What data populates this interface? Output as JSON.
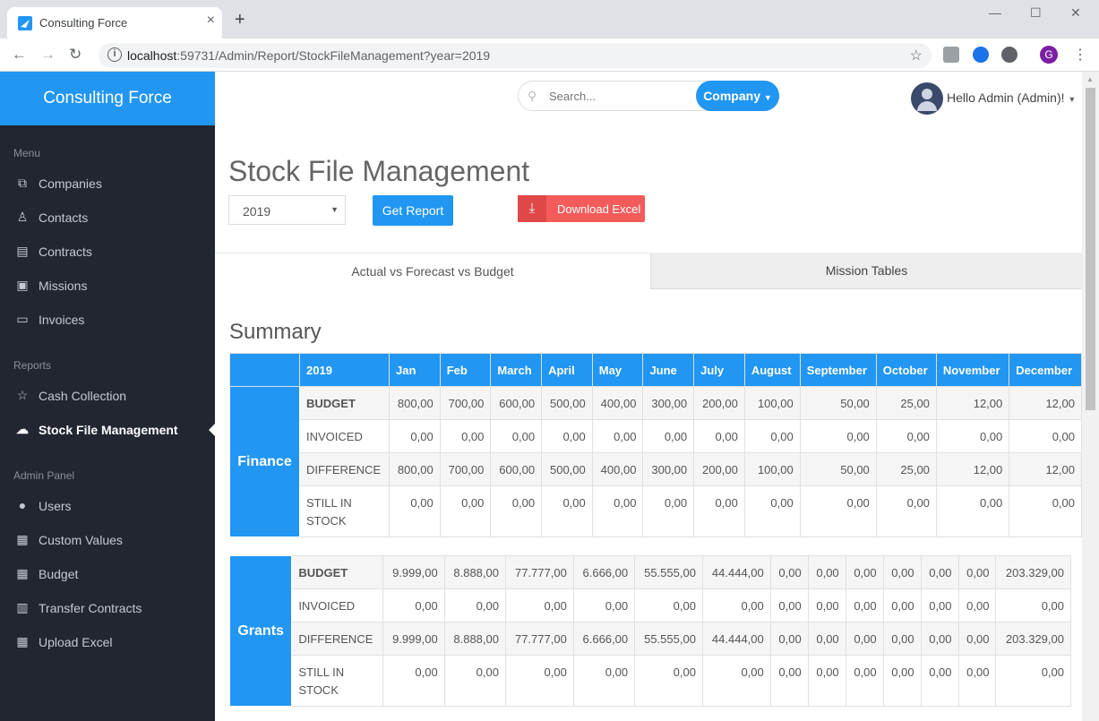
{
  "browser": {
    "tab_title": "Consulting Force",
    "tab_close": "×",
    "new_tab": "+",
    "url_host": "localhost",
    "url_path": ":59731/Admin/Report/StockFileManagement?year=2019",
    "profile_letter": "G",
    "icons": [
      "back-icon",
      "forward-icon",
      "reload-icon",
      "info-icon",
      "star-icon",
      "menu-dots-icon"
    ]
  },
  "sidebar": {
    "brand": "Consulting Force",
    "sections": {
      "menu": "Menu",
      "reports": "Reports",
      "admin": "Admin Panel"
    },
    "menu_items": [
      {
        "label": "Companies",
        "icon": "companies-icon"
      },
      {
        "label": "Contacts",
        "icon": "contacts-icon"
      },
      {
        "label": "Contracts",
        "icon": "contracts-icon"
      },
      {
        "label": "Missions",
        "icon": "missions-icon"
      },
      {
        "label": "Invoices",
        "icon": "invoices-icon"
      }
    ],
    "report_items": [
      {
        "label": "Cash Collection",
        "icon": "star-icon"
      },
      {
        "label": "Stock File Management",
        "icon": "cloud-upload-icon",
        "active": true
      }
    ],
    "admin_items": [
      {
        "label": "Users",
        "icon": "user-icon"
      },
      {
        "label": "Custom Values",
        "icon": "grid-icon"
      },
      {
        "label": "Budget",
        "icon": "grid-icon"
      },
      {
        "label": "Transfer Contracts",
        "icon": "train-icon"
      },
      {
        "label": "Upload Excel",
        "icon": "grid-icon"
      }
    ]
  },
  "header": {
    "search_placeholder": "Search...",
    "company_button": "Company",
    "user_greeting": "Hello Admin (Admin)!"
  },
  "page": {
    "title": "Stock File Management",
    "year_value": "2019",
    "get_report": "Get Report",
    "download_excel": "Download Excel",
    "tabs": [
      "Actual vs Forecast vs Budget",
      "Mission Tables"
    ],
    "summary_title": "Summary"
  },
  "finance_table": {
    "year_header": "2019",
    "months": [
      "Jan",
      "Feb",
      "March",
      "April",
      "May",
      "June",
      "July",
      "August",
      "September",
      "October",
      "November",
      "December"
    ],
    "group": "Finance",
    "rows": [
      {
        "label": "BUDGET",
        "values": [
          "800,00",
          "700,00",
          "600,00",
          "500,00",
          "400,00",
          "300,00",
          "200,00",
          "100,00",
          "50,00",
          "25,00",
          "12,00",
          "12,00"
        ]
      },
      {
        "label": "INVOICED",
        "values": [
          "0,00",
          "0,00",
          "0,00",
          "0,00",
          "0,00",
          "0,00",
          "0,00",
          "0,00",
          "0,00",
          "0,00",
          "0,00",
          "0,00"
        ]
      },
      {
        "label": "DIFFERENCE",
        "values": [
          "800,00",
          "700,00",
          "600,00",
          "500,00",
          "400,00",
          "300,00",
          "200,00",
          "100,00",
          "50,00",
          "25,00",
          "12,00",
          "12,00"
        ]
      },
      {
        "label": "STILL IN STOCK",
        "label_line1": "STILL IN",
        "label_line2": "STOCK",
        "values": [
          "0,00",
          "0,00",
          "0,00",
          "0,00",
          "0,00",
          "0,00",
          "0,00",
          "0,00",
          "0,00",
          "0,00",
          "0,00",
          "0,00"
        ]
      }
    ]
  },
  "grants_table": {
    "group": "Grants",
    "rows": [
      {
        "label": "BUDGET",
        "values": [
          "9.999,00",
          "8.888,00",
          "77.777,00",
          "6.666,00",
          "55.555,00",
          "44.444,00",
          "0,00",
          "0,00",
          "0,00",
          "0,00",
          "0,00",
          "0,00",
          "203.329,00"
        ]
      },
      {
        "label": "INVOICED",
        "values": [
          "0,00",
          "0,00",
          "0,00",
          "0,00",
          "0,00",
          "0,00",
          "0,00",
          "0,00",
          "0,00",
          "0,00",
          "0,00",
          "0,00",
          "0,00"
        ]
      },
      {
        "label": "DIFFERENCE",
        "values": [
          "9.999,00",
          "8.888,00",
          "77.777,00",
          "6.666,00",
          "55.555,00",
          "44.444,00",
          "0,00",
          "0,00",
          "0,00",
          "0,00",
          "0,00",
          "0,00",
          "203.329,00"
        ]
      },
      {
        "label": "STILL IN STOCK",
        "label_line1": "STILL IN",
        "label_line2": "STOCK",
        "values": [
          "0,00",
          "0,00",
          "0,00",
          "0,00",
          "0,00",
          "0,00",
          "0,00",
          "0,00",
          "0,00",
          "0,00",
          "0,00",
          "0,00",
          "0,00"
        ]
      }
    ]
  },
  "colors": {
    "accent": "#2196f3",
    "sidebar_bg": "#222631",
    "danger": "#f45b5b"
  }
}
